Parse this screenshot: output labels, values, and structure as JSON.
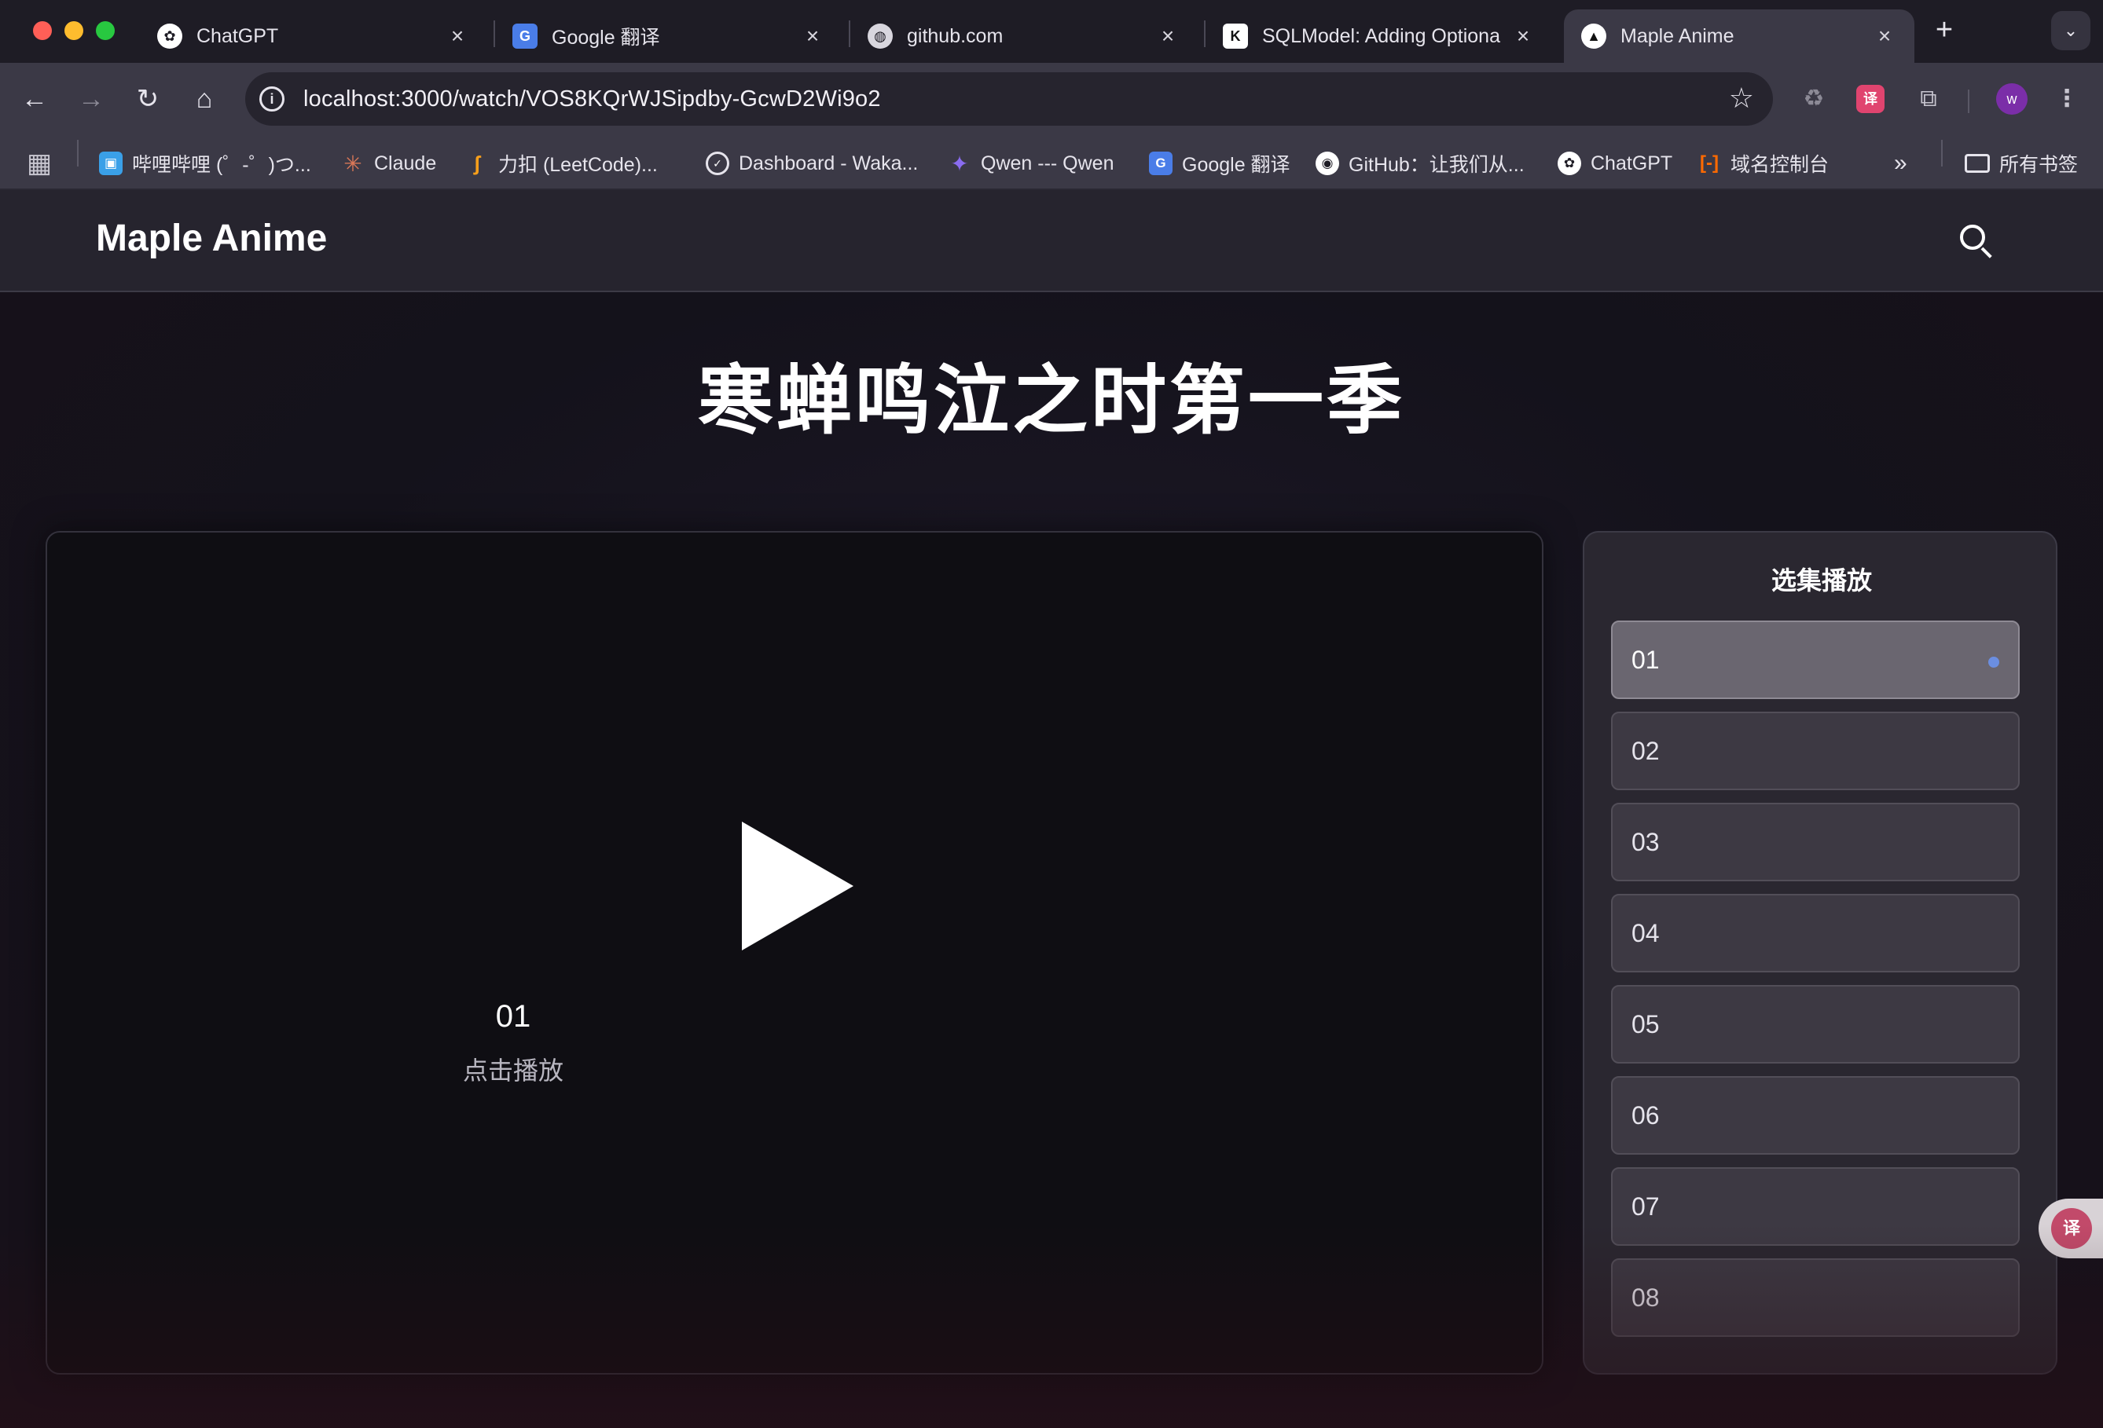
{
  "browser": {
    "tabs": [
      {
        "title": "ChatGPT",
        "icon": "chatgpt-icon",
        "active": false
      },
      {
        "title": "Google 翻译",
        "icon": "google-translate-icon",
        "active": false
      },
      {
        "title": "github.com",
        "icon": "globe-icon",
        "active": false
      },
      {
        "title": "SQLModel: Adding Optiona",
        "icon": "k-icon",
        "active": false
      },
      {
        "title": "Maple Anime",
        "icon": "triangle-logo-icon",
        "active": true
      }
    ],
    "url": "localhost:3000/watch/VOS8KQrWJSipdby-GcwD2Wi9o2",
    "avatar_letter": "w",
    "bookmarks": [
      {
        "label": "哔哩哔哩 (゜-゜)つ...",
        "icon": "bilibili-icon",
        "color": "#3aa0e8"
      },
      {
        "label": "Claude",
        "icon": "claude-icon",
        "color": "#d97757"
      },
      {
        "label": "力扣 (LeetCode)...",
        "icon": "leetcode-icon",
        "color": "#f89f1b"
      },
      {
        "label": "Dashboard - Waka...",
        "icon": "wakatime-icon",
        "color": "#111111"
      },
      {
        "label": "Qwen --- Qwen",
        "icon": "qwen-icon",
        "color": "#6a4ce0"
      },
      {
        "label": "Google 翻译",
        "icon": "google-translate-icon",
        "color": "#4a7de8"
      },
      {
        "label": "GitHub：让我们从...",
        "icon": "github-icon",
        "color": "#ffffff"
      },
      {
        "label": "ChatGPT",
        "icon": "chatgpt-icon",
        "color": "#ffffff"
      },
      {
        "label": "域名控制台",
        "icon": "aliyun-icon",
        "color": "#ff6a00"
      }
    ],
    "all_bookmarks": "所有书签"
  },
  "app": {
    "brand": "Maple Anime",
    "show_title": "寒蝉鸣泣之时第一季",
    "player": {
      "episode": "01",
      "hint": "点击播放"
    },
    "episode_panel": {
      "title": "选集播放",
      "episodes": [
        "01",
        "02",
        "03",
        "04",
        "05",
        "06",
        "07",
        "08"
      ],
      "active": "01"
    }
  },
  "colors": {
    "page_bg": "#14121b",
    "active_dot": "#6b8ee0"
  }
}
